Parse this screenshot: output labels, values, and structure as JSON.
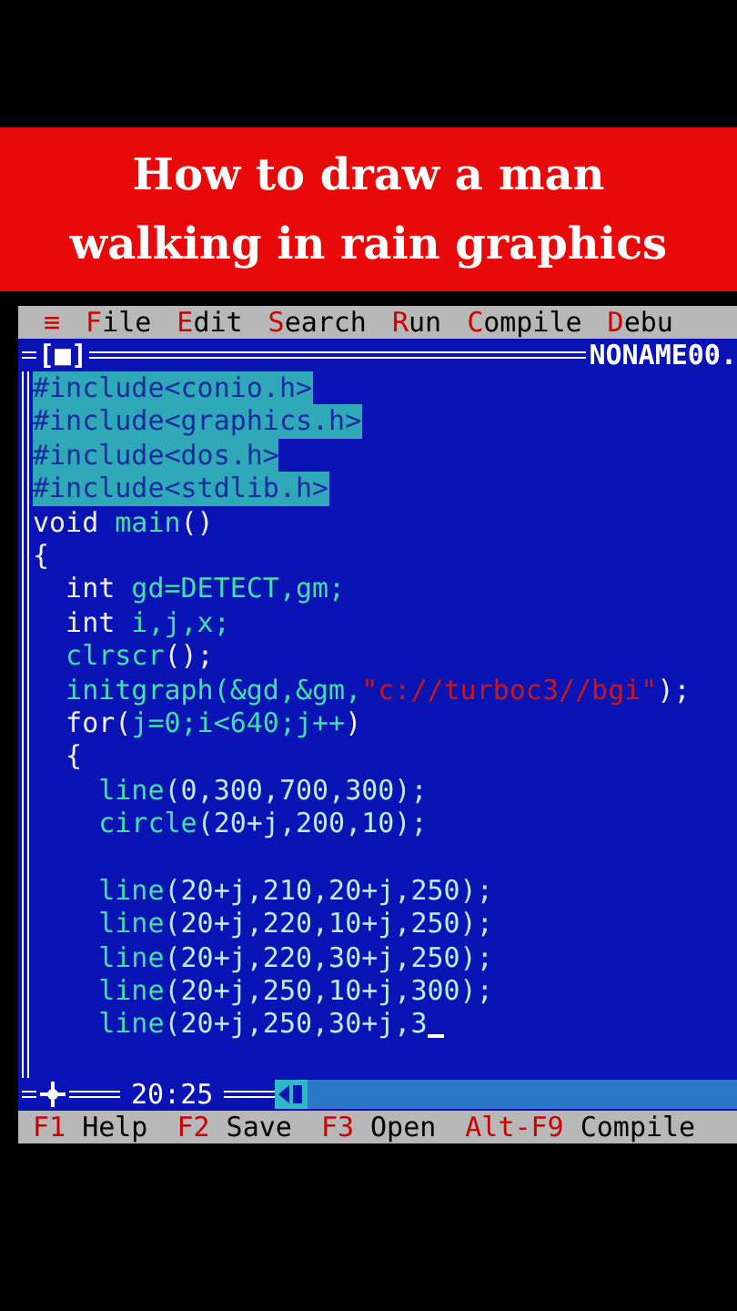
{
  "banner": {
    "title_lines": [
      "How to draw a man",
      "walking in rain graphics"
    ]
  },
  "menu_bar": {
    "items": [
      {
        "label": "≡"
      },
      {
        "label": "File"
      },
      {
        "label": "Edit"
      },
      {
        "label": "Search"
      },
      {
        "label": "Run"
      },
      {
        "label": "Compile"
      },
      {
        "label": "Debu"
      }
    ]
  },
  "editor": {
    "close_box": "[■]",
    "file_name": "NONAME00.",
    "position": "20:25",
    "lines": [
      {
        "selected": true,
        "cursor": false,
        "parts": [
          {
            "text": "#include<conio.h>"
          }
        ]
      },
      {
        "selected": true,
        "cursor": false,
        "parts": [
          {
            "text": "#include<graphics.h>"
          }
        ]
      },
      {
        "selected": true,
        "cursor": false,
        "parts": [
          {
            "text": "#include<dos.h>"
          }
        ]
      },
      {
        "selected": true,
        "cursor": false,
        "parts": [
          {
            "text": "#include<stdlib.h>"
          }
        ]
      },
      {
        "selected": false,
        "cursor": false,
        "parts": [
          {
            "text": "void",
            "kind": "keyword"
          },
          {
            "text": " main",
            "kind": "ident"
          },
          {
            "text": "()",
            "kind": "keyword"
          }
        ]
      },
      {
        "selected": false,
        "cursor": false,
        "parts": [
          {
            "text": "{",
            "kind": "keyword"
          }
        ]
      },
      {
        "selected": false,
        "cursor": false,
        "parts": [
          {
            "text": "  int",
            "kind": "keyword"
          },
          {
            "text": " gd=DETECT,gm;",
            "kind": "ident"
          }
        ]
      },
      {
        "selected": false,
        "cursor": false,
        "parts": [
          {
            "text": "  int",
            "kind": "keyword"
          },
          {
            "text": " i,j,x;",
            "kind": "ident"
          }
        ]
      },
      {
        "selected": false,
        "cursor": false,
        "parts": [
          {
            "text": "  clrscr",
            "kind": "ident"
          },
          {
            "text": "();",
            "kind": "keyword"
          }
        ]
      },
      {
        "selected": false,
        "cursor": false,
        "parts": [
          {
            "text": "  initgraph(&gd,&gm,",
            "kind": "ident"
          },
          {
            "text": "\"c://turboc3//bgi\"",
            "kind": "string"
          },
          {
            "text": ");",
            "kind": "keyword"
          }
        ]
      },
      {
        "selected": false,
        "cursor": false,
        "parts": [
          {
            "text": "  for(",
            "kind": "keyword"
          },
          {
            "text": "j=0;i<640;j++",
            "kind": "ident"
          },
          {
            "text": ")",
            "kind": "keyword"
          }
        ]
      },
      {
        "selected": false,
        "cursor": false,
        "parts": [
          {
            "text": "  {",
            "kind": "keyword"
          }
        ]
      },
      {
        "selected": false,
        "cursor": false,
        "parts": [
          {
            "text": "    line",
            "kind": "ident"
          },
          {
            "text": "(0,300,700,300);",
            "kind": "plain"
          }
        ]
      },
      {
        "selected": false,
        "cursor": false,
        "parts": [
          {
            "text": "    circle",
            "kind": "ident"
          },
          {
            "text": "(20+j,200,10);",
            "kind": "plain"
          }
        ]
      },
      {
        "cursor": false
      },
      {
        "selected": false,
        "cursor": false,
        "parts": [
          {
            "text": "    line",
            "kind": "ident"
          },
          {
            "text": "(20+j,210,20+j,250);",
            "kind": "plain"
          }
        ]
      },
      {
        "selected": false,
        "cursor": false,
        "parts": [
          {
            "text": "    line",
            "kind": "ident"
          },
          {
            "text": "(20+j,220,10+j,250);",
            "kind": "plain"
          }
        ]
      },
      {
        "selected": false,
        "cursor": false,
        "parts": [
          {
            "text": "    line",
            "kind": "ident"
          },
          {
            "text": "(20+j,220,30+j,250);",
            "kind": "plain"
          }
        ]
      },
      {
        "selected": false,
        "cursor": false,
        "parts": [
          {
            "text": "    line",
            "kind": "ident"
          },
          {
            "text": "(20+j,250,10+j,300);",
            "kind": "plain"
          }
        ]
      },
      {
        "selected": false,
        "cursor": true,
        "parts": [
          {
            "text": "    line",
            "kind": "ident"
          },
          {
            "text": "(20+j,250,30+j,3",
            "kind": "plain"
          }
        ]
      }
    ]
  },
  "status_bar": {
    "items": [
      {
        "key": "F1",
        "label": "Help"
      },
      {
        "key": "F2",
        "label": "Save"
      },
      {
        "key": "F3",
        "label": "Open"
      },
      {
        "key": "Alt-F9",
        "label": "Compile"
      }
    ]
  }
}
